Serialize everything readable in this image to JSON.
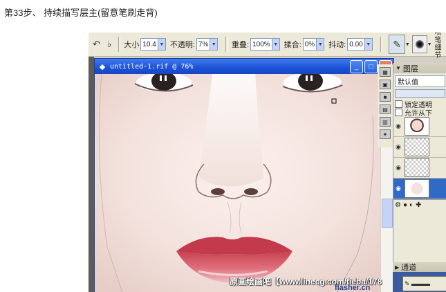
{
  "caption": "第33步、 持续描写层主(留意笔刷走背)",
  "toolbar": {
    "size_label": "大小",
    "size_value": "10.4",
    "opacity_label": "不透明:",
    "opacity_value": "7%",
    "overlap_label": "重叠:",
    "overlap_value": "100%",
    "blend_label": "揉合:",
    "blend_value": "0%",
    "jitter_label": "抖动:",
    "jitter_value": "0.00",
    "right_label_1": "喷笔",
    "right_label_2": "细节"
  },
  "document": {
    "title": "untitled-1.rif @ 76%"
  },
  "layers_panel": {
    "title": "图层",
    "composite_value": "默认值",
    "lock_transparency": "锁定透明",
    "allow_below": "允许从下"
  },
  "channels_panel": {
    "title": "通道"
  },
  "watermark": {
    "text": "原画绘画吧【www.linecg.com/tieba/178",
    "site": "flasher.cn"
  }
}
